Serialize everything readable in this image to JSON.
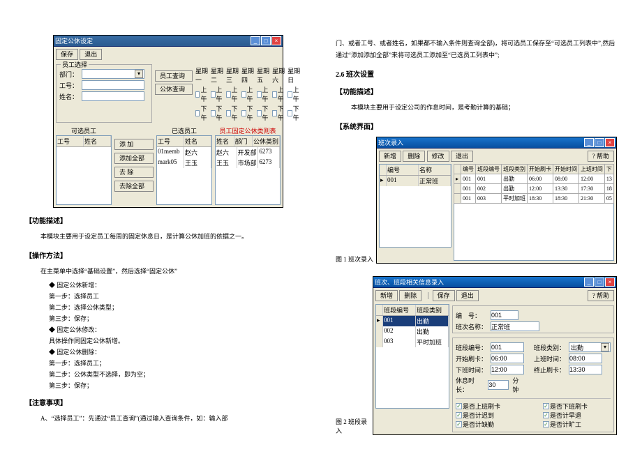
{
  "screenshot1": {
    "title": "固定公休设定",
    "toolbar": {
      "save": "保存",
      "exit": "退出"
    },
    "employee_select": {
      "legend": "员工选择",
      "dept_label": "部门：",
      "empno_label": "工号：",
      "name_label": "姓名：",
      "query_emp": "员工查询",
      "query_leave": "公休查询"
    },
    "days": {
      "headers": [
        "星期一",
        "星期二",
        "星期三",
        "星期四",
        "星期五",
        "星期六",
        "星期日"
      ],
      "am": "上午",
      "pm": "下午"
    },
    "candidate": {
      "title": "可选员工",
      "cols": [
        "工号",
        "姓名"
      ],
      "add": "添 加",
      "add_all": "添加全部",
      "del": "去 除",
      "del_all": "去除全部"
    },
    "selected": {
      "title": "已选员工",
      "cols": [
        "工号",
        "姓名"
      ],
      "rows": [
        [
          "01memb",
          "赵六"
        ],
        [
          "mark05",
          "王玉"
        ]
      ]
    },
    "result": {
      "title": "员工固定公休类则表",
      "cols": [
        "姓名",
        "部门",
        "公休类别"
      ],
      "rows": [
        [
          "赵六",
          "开发部",
          "6273"
        ],
        [
          "王玉",
          "市场部",
          "6273"
        ]
      ]
    }
  },
  "doc_left": {
    "h1": "【功能描述】",
    "p1": "本模块主要用于设定员工每周的固定休息日，是计算公休加班的依据之一。",
    "h2": "【操作方法】",
    "p2": "在主菜单中选择“基础设置”，然后选择“固定公休”",
    "b1": "固定公休新增：",
    "s1": "第一步：选择员工",
    "s2": "第二步：选择公休类型；",
    "s3": "第三步：保存；",
    "b2": "固定公休修改：",
    "p3": "具体操作同固定公休新增。",
    "b3": "固定公休删除：",
    "s4": "第一步：选择员工；",
    "s5": "第二步：公休类型不选择，即为空；",
    "s6": "第三步：保存；",
    "h3": "【注意事项】",
    "p4": "A、“选择员工”：先通过“员工查询”(通过输入查询条件，如：输入部"
  },
  "doc_right": {
    "cont": "门、或者工号、或者姓名，如果都不输入条件则查询全部)，将可选员工保存至“可选员工列表中”,然后通过“添加添加全部”来将可选员工添加至“已选员工列表中”;",
    "h1": "2.6 班次设置",
    "h2": "【功能描述】",
    "p1": "本模块主要用于设定公司的作息时间，是考勤计算的基础；",
    "h3": "【系统界面】",
    "c1": "图 1 班次录入",
    "c2": "图 2 班段录入"
  },
  "win1": {
    "title": "班次录入",
    "tb": {
      "add": "新增",
      "del": "删除",
      "mod": "修改",
      "exit": "退出",
      "help": "? 帮助"
    },
    "list": {
      "cols": [
        "编号",
        "名称"
      ],
      "rows": [
        [
          "001",
          "正常班"
        ]
      ]
    },
    "grid": {
      "cols": [
        "编号",
        "班段编号",
        "班段类别",
        "开始刷卡",
        "开始时间",
        "上班时间",
        "下"
      ],
      "rows": [
        [
          "001",
          "001",
          "出勤",
          "06:00",
          "08:00",
          "12:00",
          "13"
        ],
        [
          "001",
          "002",
          "出勤",
          "12:00",
          "13:30",
          "17:30",
          "18"
        ],
        [
          "001",
          "003",
          "平时加班",
          "18:30",
          "18:30",
          "21:30",
          "05"
        ]
      ]
    }
  },
  "win2": {
    "title": "班次、班段相关信息录入",
    "tb": {
      "add": "新增",
      "del": "删除",
      "save": "保存",
      "exit": "退出",
      "help": "? 帮助"
    },
    "tab1": "班段编号",
    "tab2": "班段类别",
    "left_rows": [
      [
        "001",
        "出勤"
      ],
      [
        "002",
        "出勤"
      ],
      [
        "003",
        "平时加班"
      ]
    ],
    "form": {
      "id_label": "编　号：",
      "id_val": "001",
      "name_label": "班次名称：",
      "name_val": "正常班",
      "seg_label": "班段编号：",
      "seg_val": "001",
      "type_label": "班段类别：",
      "type_val": "出勤",
      "start_swipe_l": "开始刷卡：",
      "start_swipe_v": "06:00",
      "start_l": "上班时间：",
      "start_v": "08:00",
      "end_l": "下班时间：",
      "end_v": "12:00",
      "end_swipe_l": "终止刷卡：",
      "end_swipe_v": "13:30",
      "rest_l": "休息时长：",
      "rest_v": "30",
      "rest_u": "分钟"
    },
    "checks": {
      "a": "是否上班刷卡",
      "b": "是否下班刷卡",
      "c": "是否计迟到",
      "d": "是否计早退",
      "e": "是否计缺勤",
      "f": "是否计旷工"
    }
  }
}
